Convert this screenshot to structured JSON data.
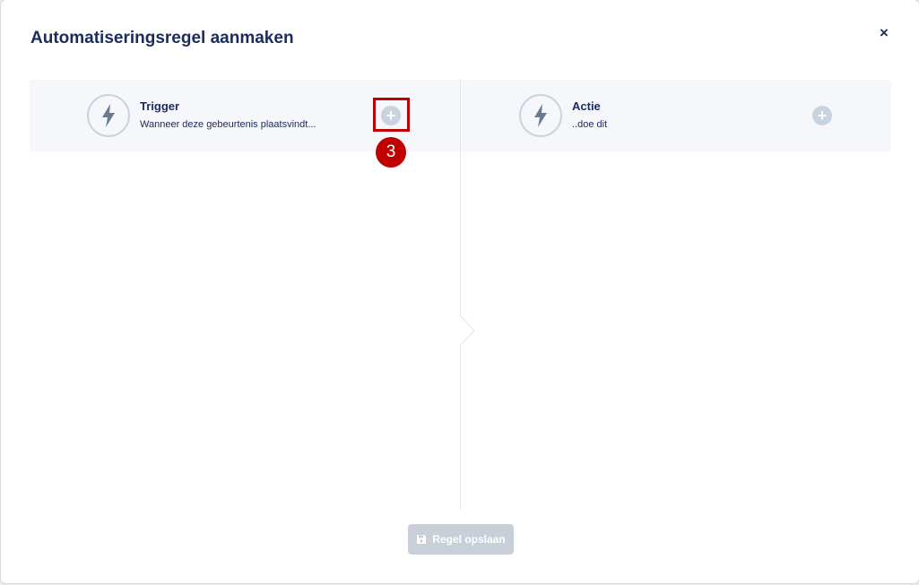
{
  "modal": {
    "title": "Automatiseringsregel aanmaken",
    "close_label": "×"
  },
  "trigger": {
    "title": "Trigger",
    "subtitle": "Wanneer deze gebeurtenis plaatsvindt...",
    "icon": "lightning-icon"
  },
  "action": {
    "title": "Actie",
    "subtitle": "..doe dit",
    "icon": "lightning-cycle-icon"
  },
  "annotation": {
    "step_number": "3"
  },
  "footer": {
    "save_label": "Regel opslaan",
    "save_icon": "floppy-disk-icon"
  },
  "colors": {
    "primary_text": "#1b2c5c",
    "panel_bg": "#f5f7fa",
    "muted": "#c9d3df",
    "highlight": "#c00000"
  }
}
